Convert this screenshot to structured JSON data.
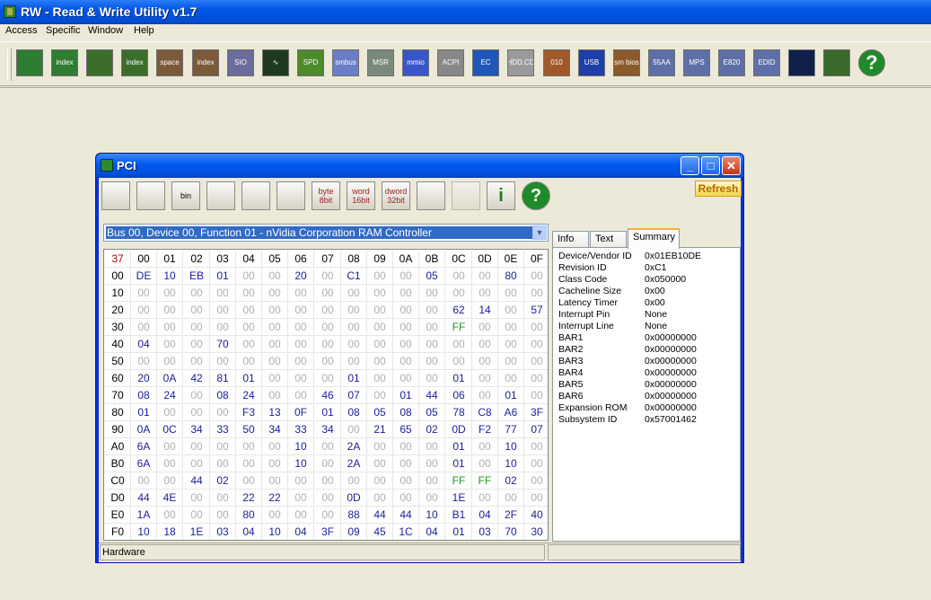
{
  "app": {
    "title": "RW - Read & Write Utility v1.7"
  },
  "menu": [
    "Access",
    "Specific",
    "Window",
    "Help"
  ],
  "toolbar_icons": [
    {
      "name": "pci-icon",
      "text": "",
      "bg": "#2e7d32"
    },
    {
      "name": "pci-index-icon",
      "text": "index",
      "bg": "#2e7d32"
    },
    {
      "name": "memory-icon",
      "text": "",
      "bg": "#3b6e2a"
    },
    {
      "name": "memory-index-icon",
      "text": "index",
      "bg": "#3b6e2a"
    },
    {
      "name": "io-space-icon",
      "text": "space",
      "bg": "#7a5a3a"
    },
    {
      "name": "io-index-icon",
      "text": "index",
      "bg": "#7a5a3a"
    },
    {
      "name": "superio-icon",
      "text": "SIO",
      "bg": "#6b6b9e"
    },
    {
      "name": "waveform-icon",
      "text": "∿",
      "bg": "#1e3a1e"
    },
    {
      "name": "spd-icon",
      "text": "SPD",
      "bg": "#4c8a2c"
    },
    {
      "name": "smbus-icon",
      "text": "smbus",
      "bg": "#6a7ec6"
    },
    {
      "name": "msr-icon",
      "text": "MSR",
      "bg": "#7a8a7a"
    },
    {
      "name": "mmio-icon",
      "text": "mmio",
      "bg": "#3a55c8"
    },
    {
      "name": "acpi-icon",
      "text": "ACPI",
      "bg": "#888888"
    },
    {
      "name": "ec-icon",
      "text": "EC",
      "bg": "#1f56b8"
    },
    {
      "name": "hdd-cd-icon",
      "text": "HDD,CD",
      "bg": "#9a9a9a"
    },
    {
      "name": "disk-icon",
      "text": "010",
      "bg": "#a05a2a"
    },
    {
      "name": "usb-icon",
      "text": "USB",
      "bg": "#1f3fa8"
    },
    {
      "name": "smbios-icon",
      "text": "sm bios",
      "bg": "#8a5a2a"
    },
    {
      "name": "table-55aa-icon",
      "text": "55AA",
      "bg": "#5e6fa8"
    },
    {
      "name": "mps-icon",
      "text": "MPS",
      "bg": "#5e6fa8"
    },
    {
      "name": "e820-icon",
      "text": "E820",
      "bg": "#5e6fa8"
    },
    {
      "name": "edid-icon",
      "text": "EDID",
      "bg": "#5e6fa8"
    },
    {
      "name": "command-prompt-icon",
      "text": "",
      "bg": "#10204a"
    },
    {
      "name": "battery-icon",
      "text": "",
      "bg": "#3a6a2a"
    },
    {
      "name": "help-icon",
      "text": "?",
      "bg": "#1f8a2a"
    }
  ],
  "pci_window": {
    "title": "PCI",
    "toolbar": [
      {
        "name": "save-icon",
        "text": ""
      },
      {
        "name": "save-all-icon",
        "text": ""
      },
      {
        "name": "save-bin-icon",
        "text": "bin"
      },
      {
        "name": "load-icon",
        "text": ""
      },
      {
        "name": "find-icon",
        "text": ""
      },
      {
        "name": "compare-icon",
        "text": ""
      },
      {
        "name": "byte-view-icon",
        "text": "byte 8bit"
      },
      {
        "name": "word-view-icon",
        "text": "word 16bit"
      },
      {
        "name": "dword-view-icon",
        "text": "dword 32bit"
      },
      {
        "name": "list-icon",
        "text": ""
      },
      {
        "name": "settings-icon",
        "text": ""
      },
      {
        "name": "info-icon",
        "text": "i"
      },
      {
        "name": "help-icon",
        "text": "?"
      }
    ],
    "refresh_label": "Refresh",
    "device_select": "Bus 00, Device 00, Function 01 - nVidia Corporation RAM Controller",
    "tabs": [
      "Info",
      "Text",
      "Summary"
    ],
    "active_tab": "Summary",
    "summary": [
      {
        "key": "Device/Vendor ID",
        "value": "0x01EB10DE"
      },
      {
        "key": "Revision ID",
        "value": "0xC1"
      },
      {
        "key": "Class Code",
        "value": "0x050000"
      },
      {
        "key": "Cacheline Size",
        "value": "0x00"
      },
      {
        "key": "Latency Timer",
        "value": "0x00"
      },
      {
        "key": "Interrupt Pin",
        "value": "None"
      },
      {
        "key": "Interrupt Line",
        "value": "None"
      },
      {
        "key": "BAR1",
        "value": "0x00000000"
      },
      {
        "key": "BAR2",
        "value": "0x00000000"
      },
      {
        "key": "BAR3",
        "value": "0x00000000"
      },
      {
        "key": "BAR4",
        "value": "0x00000000"
      },
      {
        "key": "BAR5",
        "value": "0x00000000"
      },
      {
        "key": "BAR6",
        "value": "0x00000000"
      },
      {
        "key": "Expansion ROM",
        "value": "0x00000000"
      },
      {
        "key": "Subsystem ID",
        "value": "0x57001462"
      }
    ],
    "status": "Hardware",
    "hex": {
      "corner": "37",
      "columns": [
        "00",
        "01",
        "02",
        "03",
        "04",
        "05",
        "06",
        "07",
        "08",
        "09",
        "0A",
        "0B",
        "0C",
        "0D",
        "0E",
        "0F"
      ],
      "rows": [
        {
          "addr": "00",
          "cells": [
            "DE",
            "10",
            "EB",
            "01",
            "00",
            "00",
            "20",
            "00",
            "C1",
            "00",
            "00",
            "05",
            "00",
            "00",
            "80",
            "00"
          ]
        },
        {
          "addr": "10",
          "cells": [
            "00",
            "00",
            "00",
            "00",
            "00",
            "00",
            "00",
            "00",
            "00",
            "00",
            "00",
            "00",
            "00",
            "00",
            "00",
            "00"
          ]
        },
        {
          "addr": "20",
          "cells": [
            "00",
            "00",
            "00",
            "00",
            "00",
            "00",
            "00",
            "00",
            "00",
            "00",
            "00",
            "00",
            "62",
            "14",
            "00",
            "57"
          ]
        },
        {
          "addr": "30",
          "cells": [
            "00",
            "00",
            "00",
            "00",
            "00",
            "00",
            "00",
            "00",
            "00",
            "00",
            "00",
            "00",
            "FF",
            "00",
            "00",
            "00"
          ]
        },
        {
          "addr": "40",
          "cells": [
            "04",
            "00",
            "00",
            "70",
            "00",
            "00",
            "00",
            "00",
            "00",
            "00",
            "00",
            "00",
            "00",
            "00",
            "00",
            "00"
          ]
        },
        {
          "addr": "50",
          "cells": [
            "00",
            "00",
            "00",
            "00",
            "00",
            "00",
            "00",
            "00",
            "00",
            "00",
            "00",
            "00",
            "00",
            "00",
            "00",
            "00"
          ]
        },
        {
          "addr": "60",
          "cells": [
            "20",
            "0A",
            "42",
            "81",
            "01",
            "00",
            "00",
            "00",
            "01",
            "00",
            "00",
            "00",
            "01",
            "00",
            "00",
            "00"
          ]
        },
        {
          "addr": "70",
          "cells": [
            "08",
            "24",
            "00",
            "08",
            "24",
            "00",
            "00",
            "46",
            "07",
            "00",
            "01",
            "44",
            "06",
            "00",
            "01",
            "00"
          ]
        },
        {
          "addr": "80",
          "cells": [
            "01",
            "00",
            "00",
            "00",
            "F3",
            "13",
            "0F",
            "01",
            "08",
            "05",
            "08",
            "05",
            "78",
            "C8",
            "A6",
            "3F"
          ]
        },
        {
          "addr": "90",
          "cells": [
            "0A",
            "0C",
            "34",
            "33",
            "50",
            "34",
            "33",
            "34",
            "00",
            "21",
            "65",
            "02",
            "0D",
            "F2",
            "77",
            "07"
          ]
        },
        {
          "addr": "A0",
          "cells": [
            "6A",
            "00",
            "00",
            "00",
            "00",
            "00",
            "10",
            "00",
            "2A",
            "00",
            "00",
            "00",
            "01",
            "00",
            "10",
            "00"
          ]
        },
        {
          "addr": "B0",
          "cells": [
            "6A",
            "00",
            "00",
            "00",
            "00",
            "00",
            "10",
            "00",
            "2A",
            "00",
            "00",
            "00",
            "01",
            "00",
            "10",
            "00"
          ]
        },
        {
          "addr": "C0",
          "cells": [
            "00",
            "00",
            "44",
            "02",
            "00",
            "00",
            "00",
            "00",
            "00",
            "00",
            "00",
            "00",
            "FF",
            "FF",
            "02",
            "00"
          ]
        },
        {
          "addr": "D0",
          "cells": [
            "44",
            "4E",
            "00",
            "00",
            "22",
            "22",
            "00",
            "00",
            "0D",
            "00",
            "00",
            "00",
            "1E",
            "00",
            "00",
            "00"
          ]
        },
        {
          "addr": "E0",
          "cells": [
            "1A",
            "00",
            "00",
            "00",
            "80",
            "00",
            "00",
            "00",
            "88",
            "44",
            "44",
            "10",
            "B1",
            "04",
            "2F",
            "40"
          ]
        },
        {
          "addr": "F0",
          "cells": [
            "10",
            "18",
            "1E",
            "03",
            "04",
            "10",
            "04",
            "3F",
            "09",
            "45",
            "1C",
            "04",
            "01",
            "03",
            "70",
            "30"
          ]
        }
      ]
    }
  },
  "colors": {
    "value": "#1c1c9c",
    "zero": "#b0b0b0",
    "ff": "#1a9a1a",
    "corner": "#b00000"
  }
}
